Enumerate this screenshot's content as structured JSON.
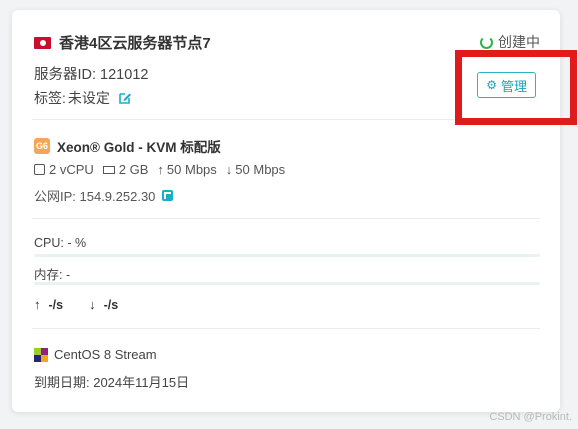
{
  "server": {
    "title": "香港4区云服务器节点7",
    "status": "创建中",
    "id_label": "服务器ID: 121012",
    "tag_label": "标签:",
    "tag_value": "未设定",
    "manage_button": "管理"
  },
  "plan": {
    "badge": "G6",
    "name": "Xeon® Gold - KVM 标配版",
    "vcpu": "2 vCPU",
    "memory": "2 GB",
    "upload": "50 Mbps",
    "download": "50 Mbps",
    "ip": "公网IP: 154.9.252.30"
  },
  "usage": {
    "cpu": "CPU: - %",
    "memory": "内存: -",
    "net_up": "-/s",
    "net_down": "-/s"
  },
  "os": {
    "name": "CentOS 8 Stream",
    "expire": "到期日期: 2024年11月15日"
  },
  "watermark": "CSDN @Prokint.",
  "colors": {
    "accent": "#16a6bb",
    "status_spinner": "#2db34a",
    "highlight": "#e01b1b"
  }
}
